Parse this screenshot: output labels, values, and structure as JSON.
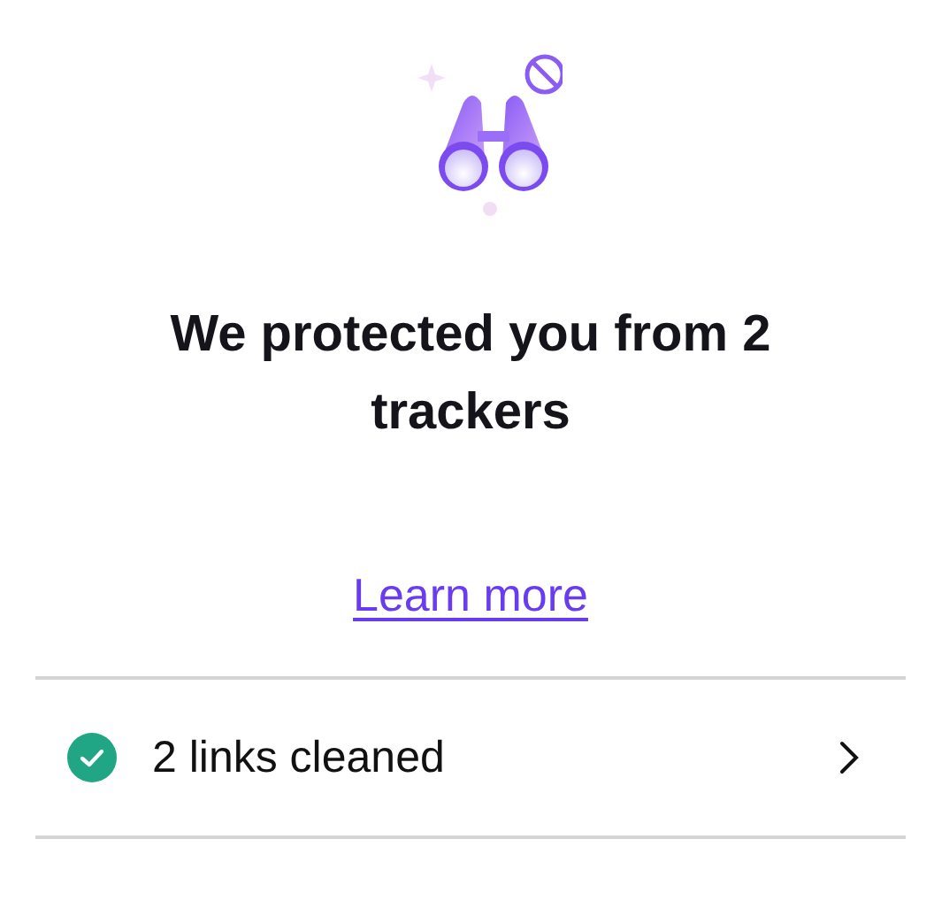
{
  "heading": "We protected you from 2 trackers",
  "link": "Learn more",
  "rows": [
    {
      "label": "2 links cleaned"
    }
  ]
}
